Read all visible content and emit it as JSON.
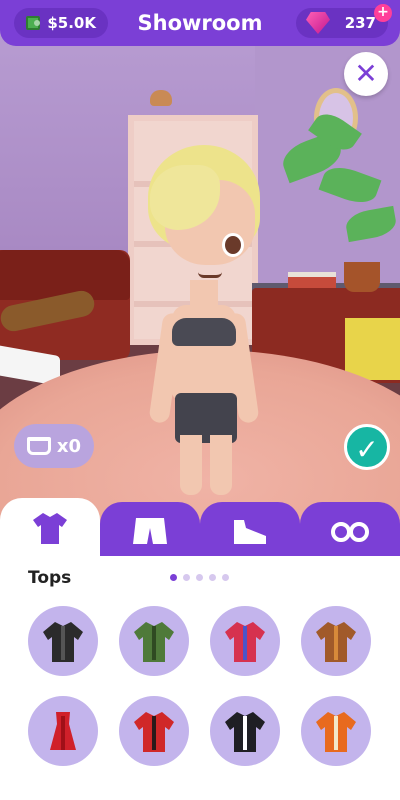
{
  "header": {
    "title": "Showroom",
    "cash": "$5.0K",
    "gems": "237",
    "gem_plus": "+",
    "cash_icon": "cash-icon",
    "gem_icon": "gem-icon"
  },
  "close_button": {
    "label": "✕",
    "icon": "close-icon"
  },
  "basket": {
    "icon": "basket-icon",
    "count": "x0"
  },
  "confirm_button": {
    "label": "✓",
    "icon": "checkmark-icon"
  },
  "tabs": [
    {
      "id": "tops",
      "icon": "shirt-icon",
      "active": true
    },
    {
      "id": "bottoms",
      "icon": "shorts-icon",
      "active": false
    },
    {
      "id": "shoes",
      "icon": "shoe-icon",
      "active": false
    },
    {
      "id": "accessories",
      "icon": "glasses-icon",
      "active": false
    }
  ],
  "category": {
    "title": "Tops",
    "pages": 5,
    "current_page": 1
  },
  "items": [
    {
      "name": "black-leather-jacket",
      "color": "#2b2b2b",
      "accent": "#555555"
    },
    {
      "name": "camo-jacket",
      "color": "#4f7a3a",
      "accent": "#2f4a22"
    },
    {
      "name": "red-blue-shirt",
      "color": "#d6324f",
      "accent": "#4a55c9"
    },
    {
      "name": "brown-plaid-coat",
      "color": "#a15a2a",
      "accent": "#d88a3a"
    },
    {
      "name": "red-dress",
      "color": "#d0202a",
      "accent": "#a01018"
    },
    {
      "name": "red-plaid-shirt",
      "color": "#d02828",
      "accent": "#2a1a1a"
    },
    {
      "name": "black-tuxedo",
      "color": "#1f1f24",
      "accent": "#ffffff"
    },
    {
      "name": "orange-vest-outfit",
      "color": "#e86a1e",
      "accent": "#f3e9c8"
    }
  ],
  "colors": {
    "accent": "#7b3fd6",
    "confirm": "#17b6a3",
    "gem": "#ff3f9a",
    "item_bg": "#c3b4ec"
  }
}
